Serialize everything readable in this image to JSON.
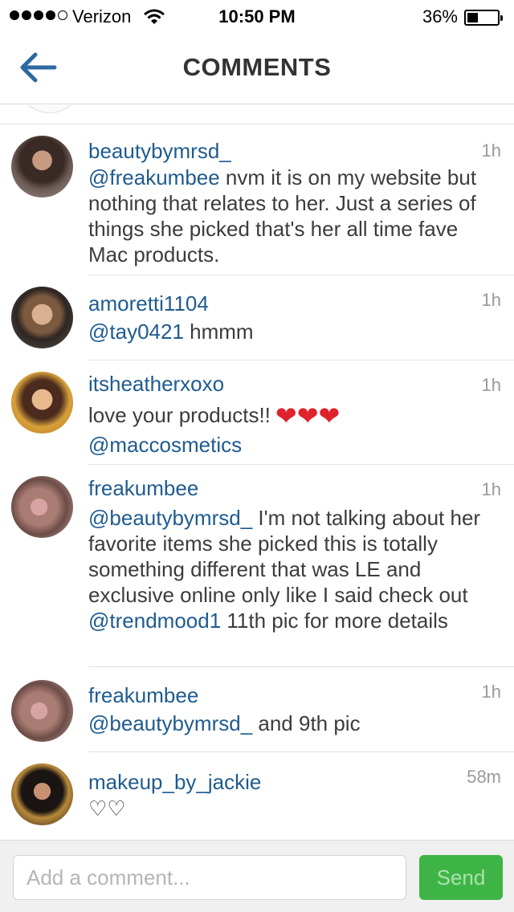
{
  "status_bar": {
    "carrier": "Verizon",
    "time": "10:50 PM",
    "battery": "36%",
    "battery_level": 0.36,
    "signal_bars": 4
  },
  "nav": {
    "title": "COMMENTS",
    "back_icon": "back-arrow-icon"
  },
  "colors": {
    "link": "#1f5b8f",
    "send_button": "#3fb446",
    "heart": "#e0222c",
    "back_arrow": "#2d6aa3"
  },
  "comments": [
    {
      "username": "beautybymrsd_",
      "time": "1h",
      "mention": "@freakumbee",
      "text": " nvm it is on my website but nothing that relates to her. Just a series of things she picked that's her all time fave Mac products."
    },
    {
      "username": "amoretti1104",
      "time": "1h",
      "mention": "@tay0421",
      "text": " hmmm"
    },
    {
      "username": "itsheatherxoxo",
      "time": "1h",
      "text": "love your products!!",
      "hearts": "❤❤❤",
      "mention": "@maccosmetics"
    },
    {
      "username": "freakumbee",
      "time": "1h",
      "mention": "@beautybymrsd_",
      "text": "  I'm not talking about her favorite items she picked this is totally something different that was LE and exclusive online only like I said check out ",
      "mention2": "@trendmood1",
      "text2": "  11th pic  for more details"
    },
    {
      "username": "freakumbee",
      "time": "1h",
      "mention": "@beautybymrsd_",
      "text": " and 9th pic"
    },
    {
      "username": "makeup_by_jackie",
      "time": "58m",
      "text": "♡♡"
    }
  ],
  "composer": {
    "placeholder": "Add a comment...",
    "send_label": "Send"
  }
}
